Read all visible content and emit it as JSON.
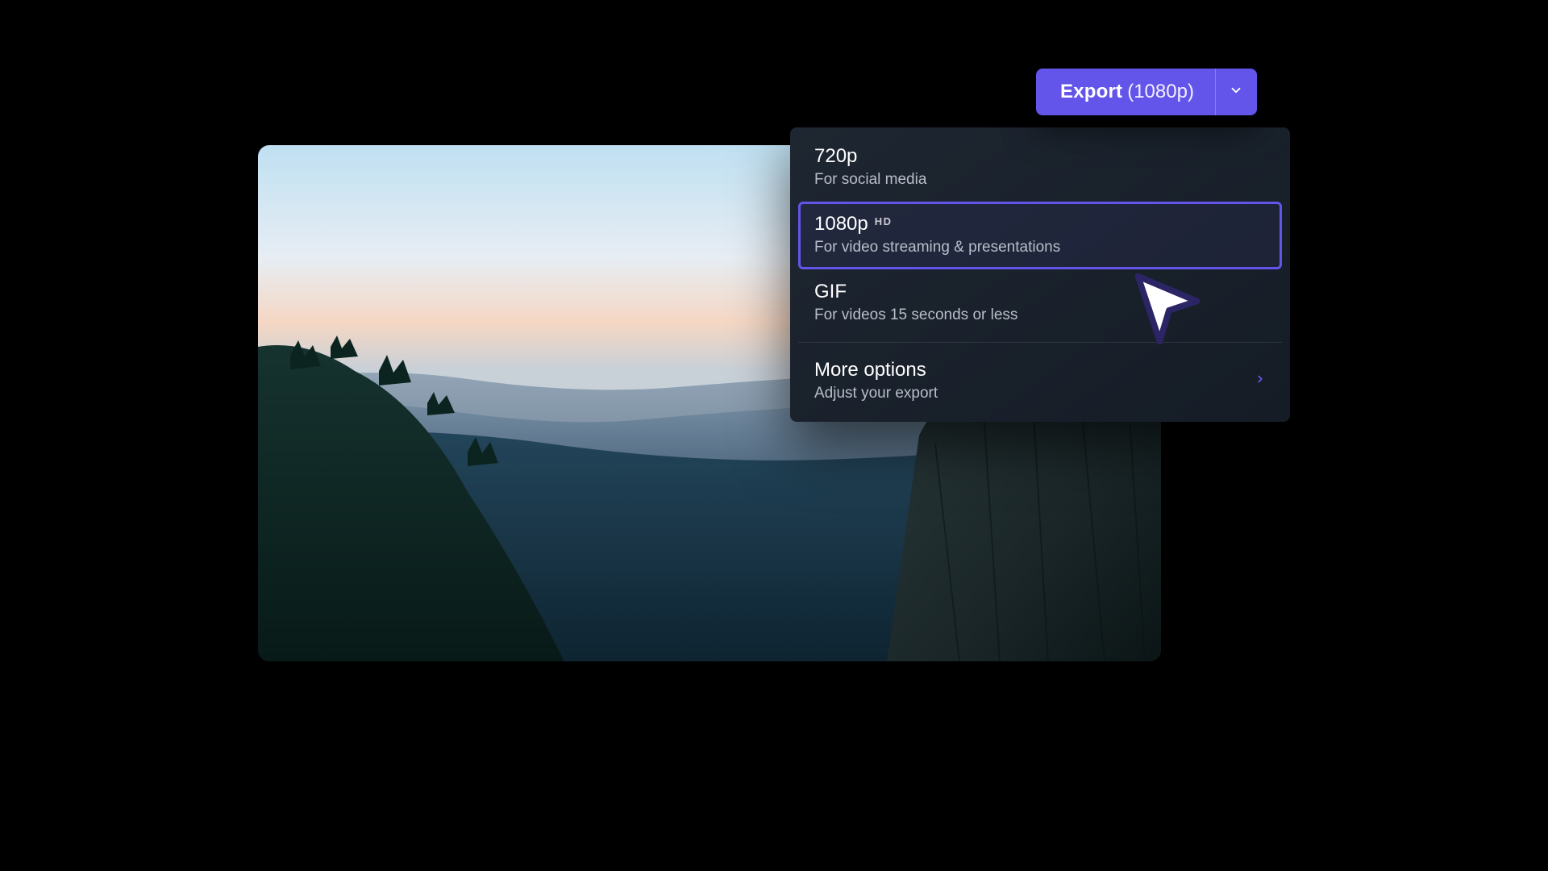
{
  "export_button": {
    "label": "Export",
    "current_resolution": "(1080p)"
  },
  "menu": {
    "items": [
      {
        "title": "720p",
        "badge": "",
        "desc": "For social media"
      },
      {
        "title": "1080p",
        "badge": "HD",
        "desc": "For video streaming & presentations",
        "selected": true
      },
      {
        "title": "GIF",
        "badge": "",
        "desc": "For videos 15 seconds or less"
      }
    ],
    "more": {
      "title": "More options",
      "desc": "Adjust your export"
    }
  },
  "colors": {
    "accent": "#6355ea"
  }
}
